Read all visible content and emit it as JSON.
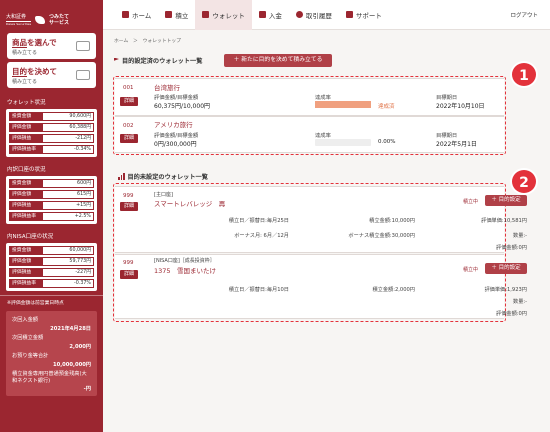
{
  "brand": {
    "logo_line1": "大和証券",
    "logo_line2": "Daiwa Securities",
    "service_line1": "つみたて",
    "service_line2": "サービス"
  },
  "sidebar": {
    "buttons": [
      {
        "title_a": "商品",
        "title_b": "を選んで",
        "sub": "積み立てる"
      },
      {
        "title_a": "目的",
        "title_b": "を決めて",
        "sub": "積み立てる"
      }
    ],
    "wallet_status": {
      "heading": "ウォレット状況",
      "rows": [
        {
          "label": "投資金額",
          "value": "90,600円"
        },
        {
          "label": "評価金額",
          "value": "60,388円"
        },
        {
          "label": "評価損益",
          "value": "-212円"
        },
        {
          "label": "評価損益率",
          "value": "-0.34%"
        }
      ]
    },
    "domestic": {
      "heading": "内訳口座の状況",
      "rows": [
        {
          "label": "投資金額",
          "value": "600円"
        },
        {
          "label": "評価金額",
          "value": "615円"
        },
        {
          "label": "評価損益",
          "value": "+15円"
        },
        {
          "label": "評価損益率",
          "value": "+2.5%"
        }
      ]
    },
    "nisa": {
      "heading": "内NISA口座の状況",
      "rows": [
        {
          "label": "投資金額",
          "value": "60,000円"
        },
        {
          "label": "評価金額",
          "value": "59,773円"
        },
        {
          "label": "評価損益",
          "value": "-227円"
        },
        {
          "label": "評価損益率",
          "value": "-0.37%"
        }
      ]
    },
    "note": "※評価金額は前営業日時点",
    "cash": {
      "next_label": "次回入金額",
      "next_date": "2021年4月28日",
      "next_accum_label": "次回積立金額",
      "next_accum_value": "2,000円",
      "deposit_label": "お預り金等合計",
      "deposit_value": "10,000,000円",
      "reserve_label": "積立資金専用円普通預金残高(大和ネクスト銀行)",
      "reserve_value": "-円"
    }
  },
  "nav": {
    "items": [
      {
        "label": "ホーム",
        "icon": "home-icon"
      },
      {
        "label": "積立",
        "icon": "chart-icon"
      },
      {
        "label": "ウォレット",
        "icon": "wallet-icon"
      },
      {
        "label": "入金",
        "icon": "deposit-icon"
      },
      {
        "label": "取引履歴",
        "icon": "history-icon"
      },
      {
        "label": "サポート",
        "icon": "support-icon"
      }
    ],
    "login": "ログアウト"
  },
  "breadcrumb": "ホーム　＞　ウォレットトップ",
  "set_section": {
    "title": "目的設定済のウォレット一覧",
    "new_button": "＋  新たに目的を決めて積み立てる",
    "badge": "1",
    "items": [
      {
        "num": "001",
        "detail": "詳細",
        "name": "台湾旅行",
        "amount_label": "評価金額/目標金額",
        "amount": "60,375円/10,000円",
        "rate_label": "達成率",
        "rate_text": "達成済",
        "rate_pct": 100,
        "date_label": "目標期日",
        "date": "2022年10月10日"
      },
      {
        "num": "002",
        "detail": "詳細",
        "name": "アメリカ旅行",
        "amount_label": "評価金額/目標金額",
        "amount": "0円/300,000円",
        "rate_label": "達成率",
        "rate_text": "0.00%",
        "rate_pct": 0,
        "date_label": "目標期日",
        "date": "2022年5月1日"
      }
    ]
  },
  "unset_section": {
    "title": "目的未設定のウォレット一覧",
    "badge": "2",
    "items": [
      {
        "num": "999",
        "detail": "詳細",
        "account": "[主口座]",
        "name": "スマートレバレッジ　再",
        "status": "積立中",
        "set_button": "＋  目的設定",
        "date": "積立日／振替日:毎月25日",
        "amount": "積立金額:10,000円",
        "unit_price": "評価単価:10,581円",
        "bonus": "ボーナス月: 6月／12月",
        "bonus_amount": "ボーナス積立金額:30,000円",
        "qty": "数量:-",
        "value": "評価金額:0円"
      },
      {
        "num": "999",
        "detail": "詳細",
        "account": "[NISA口座]［成長投資枠］",
        "name": "1375　雪国まいたけ",
        "status": "積立中",
        "set_button": "＋  目的設定",
        "date": "積立日／振替日:毎月10日",
        "amount": "積立金額:2,000円",
        "unit_price": "評価単価:1,923円",
        "qty": "数量:-",
        "value": "評価金額:0円"
      }
    ]
  },
  "colors": {
    "brand": "#9b2630",
    "accent": "#e3323b",
    "progress": "#f0a07f"
  }
}
